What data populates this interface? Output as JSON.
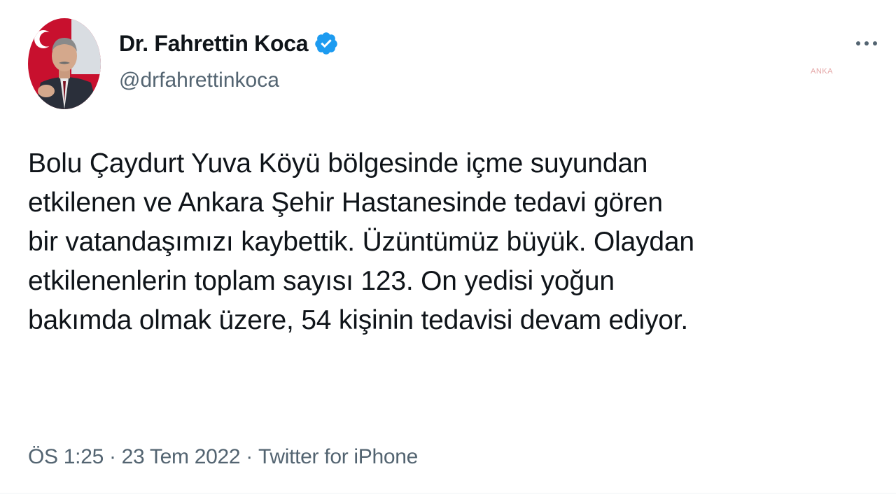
{
  "author": {
    "display_name": "Dr. Fahrettin Koca",
    "handle": "@drfahrettinkoca",
    "verified": true,
    "avatar_icon": "profile-photo"
  },
  "menu": {
    "more_icon": "more-horizontal-icon"
  },
  "watermark": "ANKA",
  "tweet": {
    "text": "Bolu Çaydurt Yuva Köyü bölgesinde içme suyundan\netkilenen ve Ankara Şehir Hastanesinde tedavi gören\nbir vatandaşımızı kaybettik. Üzüntümüz büyük. Olaydan\netkilenenlerin toplam sayısı 123. On yedisi yoğun\nbakımda olmak üzere, 54 kişinin tedavisi devam ediyor."
  },
  "meta": {
    "time": "ÖS 1:25",
    "separator": "·",
    "date": "23 Tem 2022",
    "source": "Twitter for iPhone"
  },
  "colors": {
    "text": "#0f1419",
    "secondary": "#536471",
    "verified_blue": "#1d9bf0",
    "avatar_red": "#c8102e"
  }
}
